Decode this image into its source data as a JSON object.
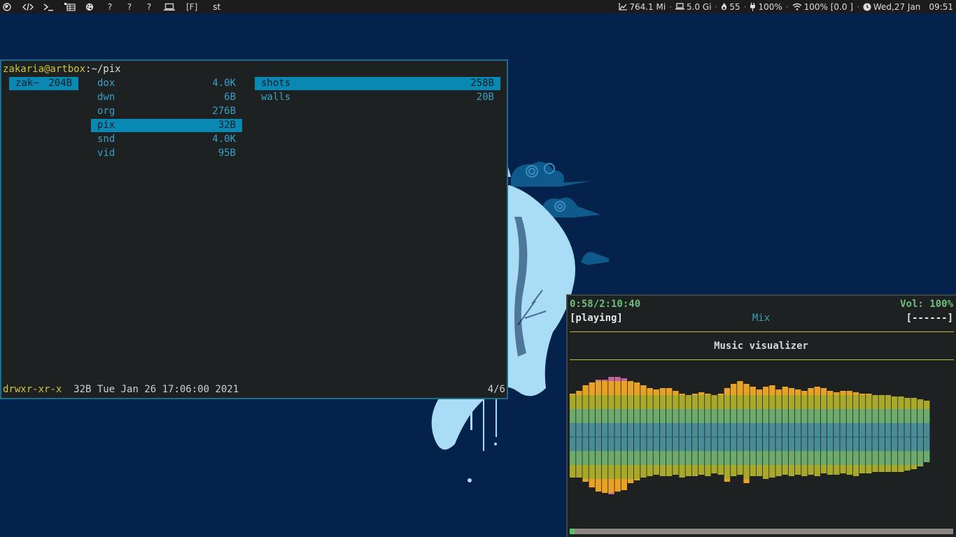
{
  "topbar": {
    "workspaces": [
      {
        "name": "globe-icon"
      },
      {
        "name": "code-icon"
      },
      {
        "name": "terminal-icon"
      },
      {
        "name": "table-icon"
      },
      {
        "name": "palette-icon"
      },
      {
        "label": "?"
      },
      {
        "label": "?"
      },
      {
        "label": "?"
      },
      {
        "name": "laptop-icon"
      }
    ],
    "layout": "[F]",
    "window_title": "st",
    "stats": {
      "memory": "764.1 Mi",
      "disk": "5.0 Gi",
      "temp": "55",
      "battery": "100%",
      "wifi": "100% [0.0 ]",
      "date": "Wed,27 Jan",
      "time": "09:51"
    }
  },
  "file_manager": {
    "user_host": "zakaria@artbox",
    "colon": ":",
    "path": "~/pix",
    "parent": {
      "name": "zak~",
      "size": "204B"
    },
    "current": [
      {
        "name": "dox",
        "size": "4.0K"
      },
      {
        "name": "dwn",
        "size": "6B"
      },
      {
        "name": "org",
        "size": "276B"
      },
      {
        "name": "pix",
        "size": "32B"
      },
      {
        "name": "snd",
        "size": "4.0K"
      },
      {
        "name": "vid",
        "size": "95B"
      }
    ],
    "preview": [
      {
        "name": "shots",
        "size": "258B"
      },
      {
        "name": "walls",
        "size": "20B"
      }
    ],
    "status": {
      "perms": "drwxr-xr-x",
      "info": "  32B Tue Jan 26 17:06:00 2021",
      "position": "4/6"
    }
  },
  "player": {
    "elapsed": "0:58/2:10:40",
    "volume": "Vol: 100%",
    "state": "[playing]",
    "title": "Mix",
    "mode": "[------]",
    "visualizer_title": "Music visualizer",
    "progress": 0.013,
    "colors": {
      "green": "#6cab6c",
      "teal": "#4a8c96",
      "olive": "#a8a82a",
      "orange": "#e8a225",
      "pink": "#c8659e"
    },
    "spectrum_top": [
      0.62,
      0.66,
      0.74,
      0.78,
      0.82,
      0.82,
      0.86,
      0.86,
      0.84,
      0.8,
      0.78,
      0.74,
      0.7,
      0.68,
      0.7,
      0.7,
      0.66,
      0.62,
      0.6,
      0.62,
      0.64,
      0.62,
      0.6,
      0.62,
      0.7,
      0.76,
      0.8,
      0.76,
      0.72,
      0.68,
      0.72,
      0.74,
      0.68,
      0.72,
      0.7,
      0.68,
      0.66,
      0.7,
      0.72,
      0.7,
      0.66,
      0.64,
      0.66,
      0.66,
      0.64,
      0.62,
      0.62,
      0.6,
      0.6,
      0.6,
      0.58,
      0.58,
      0.56,
      0.56,
      0.54,
      0.52
    ],
    "spectrum_bottom": [
      0.58,
      0.58,
      0.64,
      0.72,
      0.78,
      0.8,
      0.82,
      0.78,
      0.76,
      0.66,
      0.62,
      0.58,
      0.56,
      0.54,
      0.56,
      0.56,
      0.54,
      0.58,
      0.56,
      0.56,
      0.54,
      0.56,
      0.52,
      0.54,
      0.64,
      0.56,
      0.54,
      0.66,
      0.56,
      0.56,
      0.6,
      0.58,
      0.56,
      0.54,
      0.56,
      0.54,
      0.56,
      0.54,
      0.56,
      0.52,
      0.54,
      0.54,
      0.52,
      0.54,
      0.56,
      0.52,
      0.52,
      0.5,
      0.5,
      0.5,
      0.5,
      0.5,
      0.48,
      0.46,
      0.42,
      0.36
    ]
  }
}
